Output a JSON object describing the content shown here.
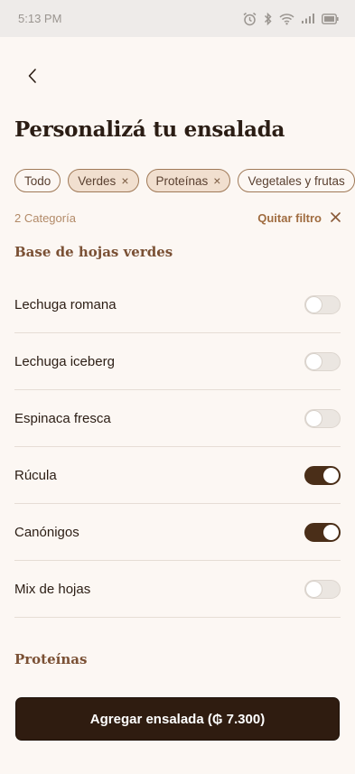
{
  "status_bar": {
    "time": "5:13 PM",
    "icons": [
      "alarm-icon",
      "bluetooth-icon",
      "wifi-icon",
      "signal-icon",
      "battery-icon"
    ]
  },
  "header": {
    "back_icon": "chevron-left-icon",
    "title": "Personalizá tu ensalada"
  },
  "chips": [
    {
      "label": "Todo",
      "selected": false,
      "removable": false
    },
    {
      "label": "Verdes",
      "selected": true,
      "removable": true,
      "remove": "×"
    },
    {
      "label": "Proteínas",
      "selected": true,
      "removable": true,
      "remove": "×"
    },
    {
      "label": "Vegetales y frutas",
      "selected": false,
      "removable": false
    }
  ],
  "filter": {
    "count_text": "2 Categoría",
    "clear_label": "Quitar filtro"
  },
  "sections": {
    "greens_title": "Base de hojas verdes",
    "proteins_title": "Proteínas"
  },
  "greens_items": [
    {
      "label": "Lechuga romana",
      "on": false
    },
    {
      "label": "Lechuga iceberg",
      "on": false
    },
    {
      "label": "Espinaca fresca",
      "on": false
    },
    {
      "label": "Rúcula",
      "on": true
    },
    {
      "label": "Canónigos",
      "on": true
    },
    {
      "label": "Mix de hojas",
      "on": false
    }
  ],
  "cta": {
    "label": "Agregar ensalada (₲ 7.300)"
  },
  "colors": {
    "background": "#fcf7f3",
    "accent_dark": "#2f1c10",
    "toggle_on": "#4a2e18",
    "chip_selected": "#f1dfcf"
  }
}
